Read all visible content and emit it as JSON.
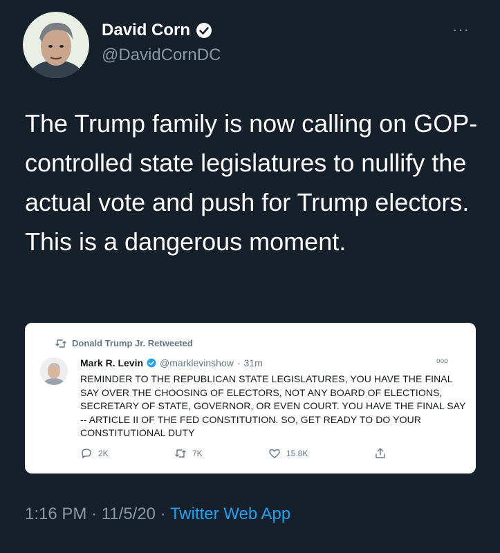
{
  "tweet": {
    "author_name": "David Corn",
    "author_handle": "@DavidCornDC",
    "text": "The Trump family is now calling on GOP-controlled state legislatures to nullify the actual vote and push for Trump electors. This is a dangerous moment.",
    "time": "1:16 PM",
    "date": "11/5/20",
    "separator": "·",
    "source": "Twitter Web App",
    "more_icon": "more-dots-icon"
  },
  "quote": {
    "retweet_note": "Donald Trump Jr. Retweeted",
    "author_name": "Mark R. Levin",
    "author_handle": "@marklevinshow",
    "separator": "·",
    "time_ago": "31m",
    "text": "REMINDER TO THE REPUBLICAN STATE LEGISLATURES, YOU HAVE THE FINAL SAY OVER THE CHOOSING OF ELECTORS, NOT ANY BOARD OF ELECTIONS, SECRETARY OF STATE, GOVERNOR, OR EVEN COURT. YOU HAVE THE FINAL SAY -- ARTICLE II OF THE FED CONSTITUTION. SO, GET READY TO DO YOUR CONSTITUTIONAL DUTY",
    "replies": "2K",
    "retweets": "7K",
    "likes": "15.8K"
  },
  "colors": {
    "background": "#15202b",
    "accent": "#1da1f2",
    "secondary_text": "#8899a6"
  }
}
